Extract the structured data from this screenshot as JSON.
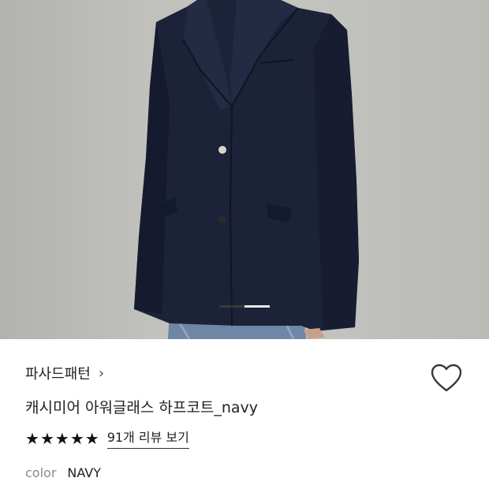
{
  "product": {
    "brand": "파사드패턴",
    "title": "캐시미어 아워글래스 하프코트_navy",
    "rating_stars": 5,
    "reviews_link": "91개 리뷰 보기",
    "color_label": "color",
    "color_value": "NAVY"
  },
  "icons": {
    "brand_chevron": "chevron-right-icon",
    "wishlist": "heart-outline-icon",
    "star": "star-filled-icon"
  },
  "carousel": {
    "total": 2,
    "current": 1
  },
  "colors": {
    "coat": "#1c2238",
    "background": "#c0c1bc",
    "accent": "#222222"
  }
}
